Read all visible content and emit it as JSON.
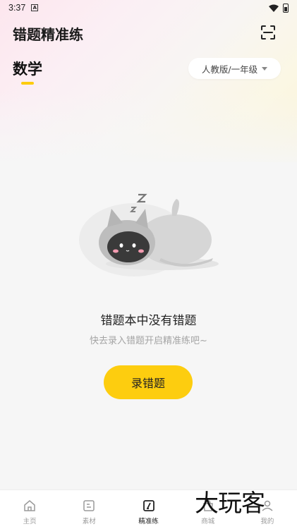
{
  "status_bar": {
    "time": "3:37",
    "notification_letter": "A"
  },
  "header": {
    "title": "错题精准练",
    "scan_icon": "scan-icon"
  },
  "subject_tabs": [
    {
      "label": "数学",
      "selected": true
    }
  ],
  "grade_selector": {
    "value": "人教版/一年级"
  },
  "empty_state": {
    "title": "错题本中没有错题",
    "subtitle": "快去录入错题开启精准练吧~",
    "button_label": "录错题"
  },
  "bottom_nav": [
    {
      "label": "主页",
      "icon": "home-icon",
      "active": false
    },
    {
      "label": "素材",
      "icon": "material-icon",
      "active": false
    },
    {
      "label": "精准练",
      "icon": "practice-icon",
      "active": true
    },
    {
      "label": "商城",
      "icon": "shop-icon",
      "active": false
    },
    {
      "label": "我的",
      "icon": "profile-icon",
      "active": false
    }
  ],
  "watermark": "大玩客",
  "colors": {
    "accent": "#fdcd0f",
    "text": "#222222",
    "muted": "#a4a4a4"
  }
}
